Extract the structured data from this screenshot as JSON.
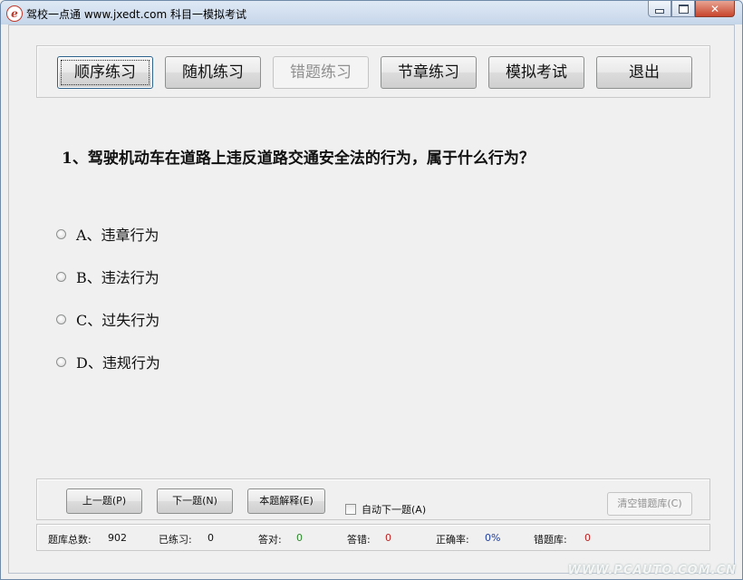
{
  "window": {
    "title": "驾校一点通 www.jxedt.com 科目一模拟考试"
  },
  "toolbar": {
    "buttons": [
      {
        "label": "顺序练习",
        "state": "focused"
      },
      {
        "label": "随机练习",
        "state": "normal"
      },
      {
        "label": "错题练习",
        "state": "disabled"
      },
      {
        "label": "节章练习",
        "state": "normal"
      },
      {
        "label": "模拟考试",
        "state": "normal"
      },
      {
        "label": "退出",
        "state": "normal"
      }
    ]
  },
  "question": {
    "text": "1、驾驶机动车在道路上违反道路交通安全法的行为，属于什么行为？",
    "options": [
      {
        "label": "A、违章行为"
      },
      {
        "label": "B、违法行为"
      },
      {
        "label": "C、过失行为"
      },
      {
        "label": "D、违规行为"
      }
    ]
  },
  "controls": {
    "prev_label": "上一题(P)",
    "next_label": "下一题(N)",
    "explain_label": "本题解释(E)",
    "auto_next_label": "自动下一题(A)",
    "auto_next_checked": false,
    "clear_wrong_label": "清空错题库(C)"
  },
  "status": {
    "total_label": "题库总数:",
    "total_value": "902",
    "practiced_label": "已练习:",
    "practiced_value": "0",
    "correct_label": "答对:",
    "correct_value": "0",
    "wrong_label": "答错:",
    "wrong_value": "0",
    "accuracy_label": "正确率:",
    "accuracy_value": "0%",
    "wrongbank_label": "错题库:",
    "wrongbank_value": "0"
  },
  "watermark": "WWW.PCAUTO.COM.CN",
  "colors": {
    "correct": "#2a8a2a",
    "wrong": "#c02020",
    "accuracy": "#2040a0"
  }
}
